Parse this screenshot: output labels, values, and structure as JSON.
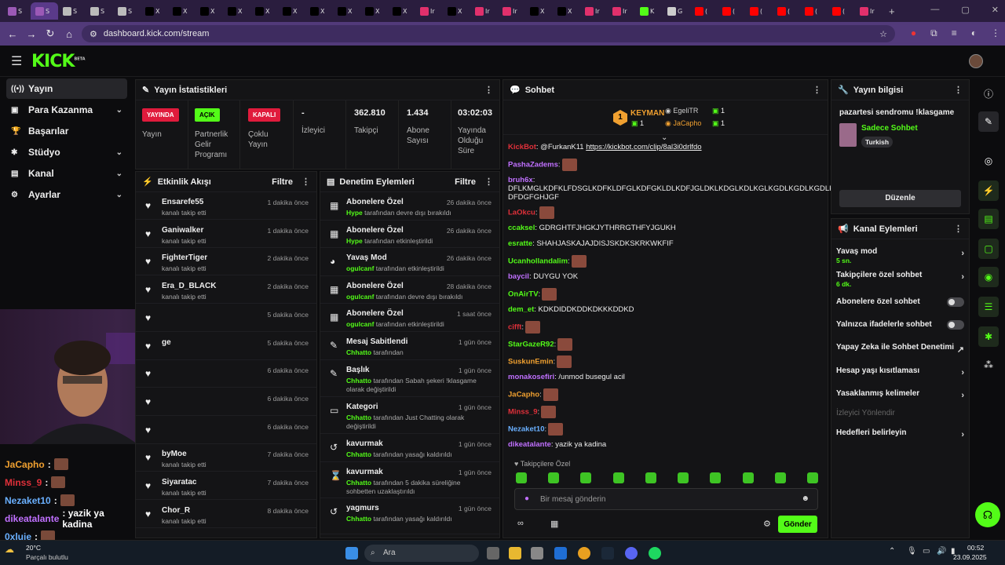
{
  "browser": {
    "url": "dashboard.kick.com/stream",
    "tabs": [
      {
        "label": "S",
        "color": "#9b59b6",
        "active": false
      },
      {
        "label": "S",
        "color": "#9b59b6",
        "active": true
      },
      {
        "label": "S",
        "color": "#bbb",
        "active": false
      },
      {
        "label": "S",
        "color": "#bbb",
        "active": false
      },
      {
        "label": "S",
        "color": "#bbb",
        "active": false
      },
      {
        "label": "X",
        "color": "#000",
        "active": false
      },
      {
        "label": "X",
        "color": "#000",
        "active": false
      },
      {
        "label": "X",
        "color": "#000",
        "active": false
      },
      {
        "label": "X",
        "color": "#000",
        "active": false
      },
      {
        "label": "X",
        "color": "#000",
        "active": false
      },
      {
        "label": "X",
        "color": "#000",
        "active": false
      },
      {
        "label": "X",
        "color": "#000",
        "active": false
      },
      {
        "label": "X",
        "color": "#000",
        "active": false
      },
      {
        "label": "X",
        "color": "#000",
        "active": false
      },
      {
        "label": "X",
        "color": "#000",
        "active": false
      },
      {
        "label": "Ir",
        "color": "#e1306c",
        "active": false
      },
      {
        "label": "X",
        "color": "#000",
        "active": false
      },
      {
        "label": "Ir",
        "color": "#e1306c",
        "active": false
      },
      {
        "label": "Ir",
        "color": "#e1306c",
        "active": false
      },
      {
        "label": "X",
        "color": "#000",
        "active": false
      },
      {
        "label": "X",
        "color": "#000",
        "active": false
      },
      {
        "label": "Ir",
        "color": "#e1306c",
        "active": false
      },
      {
        "label": "Ir",
        "color": "#e1306c",
        "active": false
      },
      {
        "label": "K",
        "color": "#53fc18",
        "active": false
      },
      {
        "label": "G",
        "color": "#ccc",
        "active": false
      },
      {
        "label": "(",
        "color": "#ff0000",
        "active": false
      },
      {
        "label": "(",
        "color": "#ff0000",
        "active": false
      },
      {
        "label": "(",
        "color": "#ff0000",
        "active": false
      },
      {
        "label": "(",
        "color": "#ff0000",
        "active": false
      },
      {
        "label": "(",
        "color": "#ff0000",
        "active": false
      },
      {
        "label": "(",
        "color": "#ff0000",
        "active": false
      },
      {
        "label": "Ir",
        "color": "#e1306c",
        "active": false
      }
    ]
  },
  "kick": {
    "logo": "KICK",
    "beta": "BETA"
  },
  "sidenav": [
    {
      "label": "Yayın",
      "icon": "((•))",
      "active": true,
      "chev": ""
    },
    {
      "label": "Para Kazanma",
      "icon": "▣",
      "chev": "⌄"
    },
    {
      "label": "Başarılar",
      "icon": "🏆",
      "chev": ""
    },
    {
      "label": "Stüdyo",
      "icon": "✱",
      "chev": "⌄"
    },
    {
      "label": "Kanal",
      "icon": "▤",
      "chev": "⌄"
    },
    {
      "label": "Ayarlar",
      "icon": "⚙",
      "chev": "⌄"
    }
  ],
  "stats": {
    "title": "Yayın İstatistikleri",
    "yayinda": "YAYINDA",
    "yayin": "Yayın",
    "acik": "AÇIK",
    "partner": "Partnerlik Gelir Programı",
    "kapali": "KAPALI",
    "coklu": "Çoklu Yayın",
    "izleyici_val": "-",
    "izleyici": "İzleyici",
    "takipci_val": "362.810",
    "takipci": "Takipçi",
    "abone_val": "1.434",
    "abone": "Abone Sayısı",
    "sure_val": "03:02:03",
    "sure": "Yayında Olduğu Süre"
  },
  "activity": {
    "title": "Etkinlik Akışı",
    "filter": "Filtre",
    "rows": [
      {
        "name": "Ensarefe55",
        "action": "kanalı takip etti",
        "time": "1 dakika önce"
      },
      {
        "name": "Ganiwalker",
        "action": "kanalı takip etti",
        "time": "1 dakika önce"
      },
      {
        "name": "FighterTiger",
        "action": "kanalı takip etti",
        "time": "2 dakika önce"
      },
      {
        "name": "Era_D_BLACK",
        "action": "kanalı takip etti",
        "time": "2 dakika önce"
      },
      {
        "name": "",
        "action": "",
        "time": "5 dakika önce"
      },
      {
        "name": "ge",
        "action": "",
        "time": "5 dakika önce"
      },
      {
        "name": "",
        "action": "",
        "time": "6 dakika önce"
      },
      {
        "name": "",
        "action": "",
        "time": "6 dakika önce"
      },
      {
        "name": "",
        "action": "",
        "time": "6 dakika önce"
      },
      {
        "name": "byMoe",
        "action": "kanalı takip etti",
        "time": "7 dakika önce"
      },
      {
        "name": "Siyaratac",
        "action": "kanalı takip etti",
        "time": "7 dakika önce"
      },
      {
        "name": "Chor_R",
        "action": "kanalı takip etti",
        "time": "8 dakika önce"
      }
    ]
  },
  "moderation": {
    "title": "Denetim Eylemleri",
    "filter": "Filtre",
    "rows": [
      {
        "icon": "▦",
        "title": "Abonelere Özel",
        "user": "Hype",
        "rest": " tarafından devre dışı bırakıldı",
        "time": "26 dakika önce"
      },
      {
        "icon": "▦",
        "title": "Abonelere Özel",
        "user": "Hype",
        "rest": " tarafından etkinleştirildi",
        "time": "26 dakika önce"
      },
      {
        "icon": "◕",
        "title": "Yavaş Mod",
        "user": "ogulcanf",
        "rest": " tarafından etkinleştirildi",
        "time": "26 dakika önce"
      },
      {
        "icon": "▦",
        "title": "Abonelere Özel",
        "user": "ogulcanf",
        "rest": " tarafından devre dışı bırakıldı",
        "time": "28 dakika önce"
      },
      {
        "icon": "▦",
        "title": "Abonelere Özel",
        "user": "ogulcanf",
        "rest": " tarafından etkinleştirildi",
        "time": "1 saat önce"
      },
      {
        "icon": "✎",
        "title": "Mesaj Sabitlendi",
        "user": "Chhatto",
        "rest": " tarafından",
        "time": "1 gün önce"
      },
      {
        "icon": "✎",
        "title": "Başlık",
        "user": "Chhatto",
        "rest": " tarafından Sabah şekeri !klasgame olarak değiştirildi",
        "time": "1 gün önce"
      },
      {
        "icon": "▭",
        "title": "Kategori",
        "user": "Chhatto",
        "rest": " tarafından Just Chatting olarak değiştirildi",
        "time": "1 gün önce"
      },
      {
        "icon": "↺",
        "title": "kavurmak",
        "user": "Chhatto",
        "rest": " tarafından yasağı kaldırıldı",
        "time": "1 gün önce"
      },
      {
        "icon": "⌛",
        "title": "kavurmak",
        "user": "Chhatto",
        "rest": " tarafından 5 dakika süreliğine sohbetten uzaklaştırıldı",
        "time": "1 gün önce"
      },
      {
        "icon": "↺",
        "title": "yagmurs",
        "user": "Chhatto",
        "rest": " tarafından yasağı kaldırıldı",
        "time": "1 gün önce"
      }
    ]
  },
  "overlay": [
    {
      "name": "JaCapho",
      "color": "#f0a030",
      "text": " :"
    },
    {
      "name": "Minss_9",
      "color": "#e0303a",
      "text": " :"
    },
    {
      "name": "Nezaket10",
      "color": "#6ab0ff",
      "text": " :"
    },
    {
      "name": "dikeatalante",
      "color": "#c070ff",
      "text": " : yazik ya kadina"
    },
    {
      "name": "0xluie",
      "color": "#6ab0ff",
      "text": " :"
    }
  ],
  "chat": {
    "title": "Sohbet",
    "leader1": "KEYMAN",
    "leader1_count": "1",
    "leader2": "EgeliTR",
    "leader2_count": "1",
    "leader3": "JaCapho",
    "leader3_count": "1",
    "messages": [
      {
        "user": "KickBot",
        "color": "#e0303a",
        "text": ": @FurkanK11 ",
        "link": "https://kickbot.com/clip/8al3i0drlfdo",
        "emote": false
      },
      {
        "user": "PashaZadems",
        "color": "#c070ff",
        "text": ":",
        "emote": true
      },
      {
        "user": "bruh6x",
        "color": "#c070ff",
        "text": ": DFLKMGLKDFKLFDSGLKDFKLDFGLKDFGKLDLKDFJGLDKLKDGLKDLKGLKGDLKGDLKGDLKG DFDGFGHJGF",
        "emote": false
      },
      {
        "user": "LaOkcu",
        "color": "#e0303a",
        "text": ":",
        "emote": true
      },
      {
        "user": "ccaksel",
        "color": "#53fc18",
        "text": ": GDRGHTFJHGKJYTHRRGTHFYJGUKH",
        "emote": false
      },
      {
        "user": "esratte",
        "color": "#53fc18",
        "text": ": SHAHJASKAJAJDISJSKDKSKRKWKFIF",
        "emote": false
      },
      {
        "user": "Ucanhollandalim",
        "color": "#53fc18",
        "text": ":",
        "emote": true
      },
      {
        "user": "baycil",
        "color": "#c070ff",
        "text": ": DUYGU YOK",
        "emote": false
      },
      {
        "user": "OnAirTV",
        "color": "#53fc18",
        "text": ":",
        "emote": true
      },
      {
        "user": "dem_et",
        "color": "#53fc18",
        "text": ": KDKDIDDKDDKDKKKDDKD",
        "emote": false
      },
      {
        "user": "cifft",
        "color": "#e0303a",
        "text": ":",
        "emote": true
      },
      {
        "user": "StarGazeR92",
        "color": "#53fc18",
        "text": ":",
        "emote": true
      },
      {
        "user": "SuskunEmin",
        "color": "#f0a030",
        "text": ":",
        "emote": true
      },
      {
        "user": "monakosefiri",
        "color": "#c070ff",
        "text": ": /unmod busegul acil",
        "emote": false
      },
      {
        "user": "JaCapho",
        "color": "#f0a030",
        "text": ":",
        "emote": true
      },
      {
        "user": "Minss_9",
        "color": "#e0303a",
        "text": ":",
        "emote": true
      },
      {
        "user": "Nezaket10",
        "color": "#6ab0ff",
        "text": ":",
        "emote": true
      },
      {
        "user": "dikeatalante",
        "color": "#c070ff",
        "text": ": yazik ya kadina",
        "emote": false
      }
    ],
    "followers_only": "Takipçilere Özel",
    "placeholder": "Bir mesaj gönderin",
    "send": "Gönder"
  },
  "streaminfo": {
    "title": "Yayın bilgisi",
    "stream_title": "pazartesi sendromu !klasgame",
    "category": "Sadece Sohbet",
    "tag": "Turkish",
    "edit": "Düzenle"
  },
  "channel": {
    "title": "Kanal Eylemleri",
    "actions": [
      {
        "label": "Yavaş mod",
        "sub": "5 sn.",
        "kind": "chev"
      },
      {
        "label": "Takipçilere özel sohbet",
        "sub": "6 dk.",
        "kind": "chev"
      },
      {
        "label": "Abonelere özel sohbet",
        "sub": "",
        "kind": "toggle"
      },
      {
        "label": "Yalnızca ifadelerle sohbet",
        "sub": "",
        "kind": "toggle"
      },
      {
        "label": "Yapay Zeka ile Sohbet Denetimi",
        "sub": "",
        "kind": "ext"
      },
      {
        "label": "Hesap yaşı kısıtlaması",
        "sub": "",
        "kind": "chev"
      },
      {
        "label": "Yasaklanmış kelimeler",
        "sub": "",
        "kind": "chev"
      },
      {
        "label": "İzleyici Yönlendir",
        "sub": "",
        "kind": "disabled"
      },
      {
        "label": "Hedefleri belirleyin",
        "sub": "",
        "kind": "chev"
      }
    ]
  },
  "taskbar": {
    "temp": "20°C",
    "weather": "Parçalı bulutlu",
    "search": "Ara",
    "time": "00:52",
    "date": "23.09.2025"
  }
}
